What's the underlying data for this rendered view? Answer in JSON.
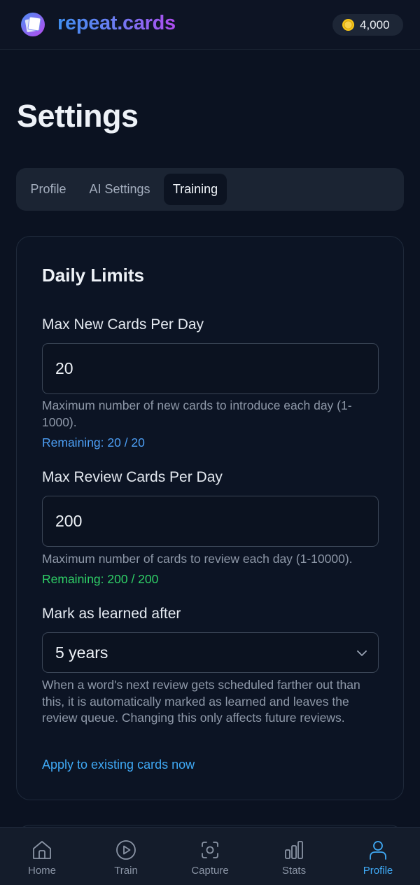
{
  "header": {
    "app_name": "repeat.cards",
    "coins": "4,000"
  },
  "page": {
    "title": "Settings"
  },
  "tabs": [
    {
      "label": "Profile",
      "active": false
    },
    {
      "label": "AI Settings",
      "active": false
    },
    {
      "label": "Training",
      "active": true
    }
  ],
  "daily_limits": {
    "title": "Daily Limits",
    "new_cards": {
      "label": "Max New Cards Per Day",
      "value": "20",
      "help": "Maximum number of new cards to introduce each day (1-1000).",
      "remaining": "Remaining: 20 / 20"
    },
    "review_cards": {
      "label": "Max Review Cards Per Day",
      "value": "200",
      "help": "Maximum number of cards to review each day (1-10000).",
      "remaining": "Remaining: 200 / 200"
    },
    "learned_after": {
      "label": "Mark as learned after",
      "selected": "5 years",
      "help": "When a word's next review gets scheduled farther out than this, it is automatically marked as learned and leaves the review queue. Changing this only affects future reviews.",
      "apply_link": "Apply to existing cards now"
    }
  },
  "bottom_nav": [
    {
      "label": "Home",
      "icon": "home-icon",
      "active": false
    },
    {
      "label": "Train",
      "icon": "play-circle-icon",
      "active": false
    },
    {
      "label": "Capture",
      "icon": "capture-icon",
      "active": false
    },
    {
      "label": "Stats",
      "icon": "bar-chart-icon",
      "active": false
    },
    {
      "label": "Profile",
      "icon": "user-icon",
      "active": true
    }
  ],
  "colors": {
    "background": "#0b1221",
    "accent": "#3fa9f5",
    "remaining_new": "#4d9ff5",
    "remaining_review": "#2fd067",
    "coin": "#f5c518"
  }
}
